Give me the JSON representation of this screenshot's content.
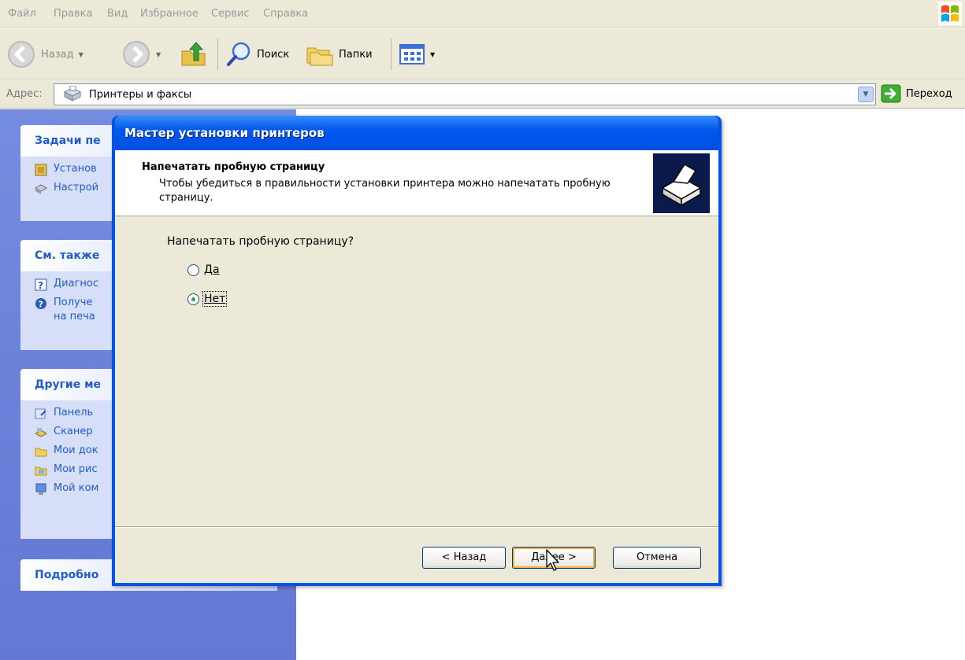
{
  "menu": [
    "Файл",
    "Правка",
    "Вид",
    "Избранное",
    "Сервис",
    "Справка"
  ],
  "toolbar": {
    "back_label": "Назад",
    "search_label": "Поиск",
    "folders_label": "Папки"
  },
  "address": {
    "label": "Адрес:",
    "value": "Принтеры и факсы",
    "go_label": "Переход"
  },
  "taskpane": {
    "panel1": {
      "title": "Задачи пе",
      "items": [
        "Установ",
        "Настрой"
      ]
    },
    "panel2": {
      "title": "См. также",
      "items": [
        "Диагнос",
        "Получе",
        "на печа"
      ]
    },
    "panel3": {
      "title": "Другие ме",
      "items": [
        "Панель",
        "Сканер",
        "Мои док",
        "Мои рис",
        "Мой ком"
      ]
    },
    "panel4": {
      "title": "Подробно"
    }
  },
  "dialog": {
    "title": "Мастер установки принтеров",
    "header_title": "Напечатать пробную страницу",
    "header_subtitle": "Чтобы убедиться в правильности установки принтера можно напечатать пробную страницу.",
    "question": "Напечатать пробную страницу?",
    "option_yes": "Да",
    "option_no": "Нет",
    "selected": "Нет",
    "back_button": "< Назад",
    "next_button": "Далее >",
    "cancel_button": "Отмена"
  }
}
